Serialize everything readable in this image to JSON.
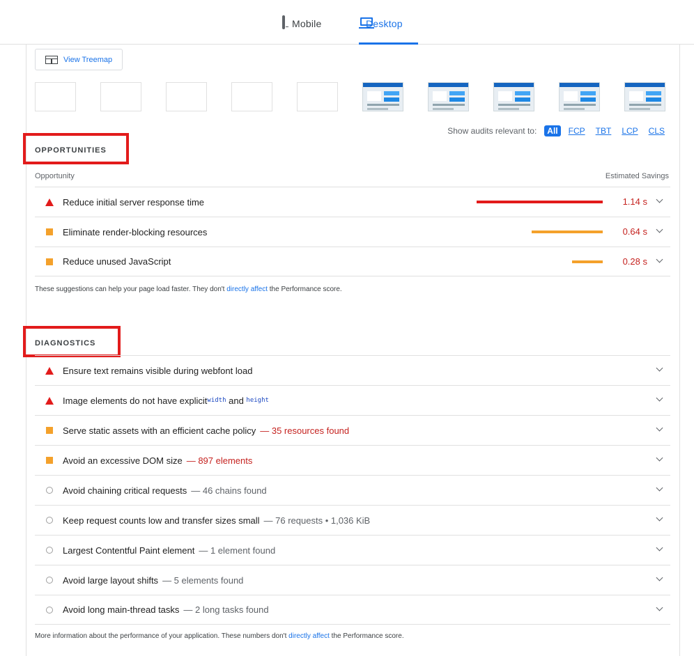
{
  "tabs": {
    "mobile_label": "Mobile",
    "desktop_label": "Desktop"
  },
  "treemap": {
    "button_label": "View Treemap"
  },
  "filmstrip": {
    "frames": [
      "blank",
      "blank",
      "blank",
      "blank",
      "blank",
      "loaded",
      "loaded",
      "loaded",
      "loaded",
      "loaded"
    ]
  },
  "filter": {
    "label": "Show audits relevant to:",
    "options": [
      "All",
      "FCP",
      "TBT",
      "LCP",
      "CLS"
    ],
    "selected": "All"
  },
  "opportunities": {
    "title": "OPPORTUNITIES",
    "col_left": "Opportunity",
    "col_right": "Estimated Savings",
    "items": [
      {
        "status": "fail",
        "title": "Reduce initial server response time",
        "savings": "1.14 s",
        "savings_value": 1.14,
        "bar_color": "#e21b1b"
      },
      {
        "status": "average",
        "title": "Eliminate render-blocking resources",
        "savings": "0.64 s",
        "savings_value": 0.64,
        "bar_color": "#f4a12b"
      },
      {
        "status": "average",
        "title": "Reduce unused JavaScript",
        "savings": "0.28 s",
        "savings_value": 0.28,
        "bar_color": "#f4a12b"
      }
    ],
    "note_before": "These suggestions can help your page load faster. They don't ",
    "note_link": "directly affect",
    "note_after": " the Performance score."
  },
  "diagnostics": {
    "title": "DIAGNOSTICS",
    "items": [
      {
        "status": "fail",
        "title": "Ensure text remains visible during webfont load",
        "display": ""
      },
      {
        "status": "fail",
        "title_pre": "Image elements do not have explicit ",
        "code1": "width",
        "title_mid": " and ",
        "code2": "height"
      },
      {
        "status": "average",
        "title": "Serve static assets with an efficient cache policy",
        "display": "— 35 resources found"
      },
      {
        "status": "average",
        "title": "Avoid an excessive DOM size",
        "display": "— 897 elements"
      },
      {
        "status": "info",
        "title": "Avoid chaining critical requests",
        "display": "— 46 chains found"
      },
      {
        "status": "info",
        "title": "Keep request counts low and transfer sizes small",
        "display": "— 76 requests • 1,036 KiB"
      },
      {
        "status": "info",
        "title": "Largest Contentful Paint element",
        "display": "— 1 element found"
      },
      {
        "status": "info",
        "title": "Avoid large layout shifts",
        "display": "— 5 elements found"
      },
      {
        "status": "info",
        "title": "Avoid long main-thread tasks",
        "display": "— 2 long tasks found"
      }
    ],
    "note_before": "More information about the performance of your application. These numbers don't ",
    "note_link": "directly affect",
    "note_after": " the Performance score."
  },
  "colors": {
    "accent": "#1a73e8",
    "fail": "#e21b1b",
    "average": "#f4a12b",
    "highlight_box": "#e21b1b"
  }
}
